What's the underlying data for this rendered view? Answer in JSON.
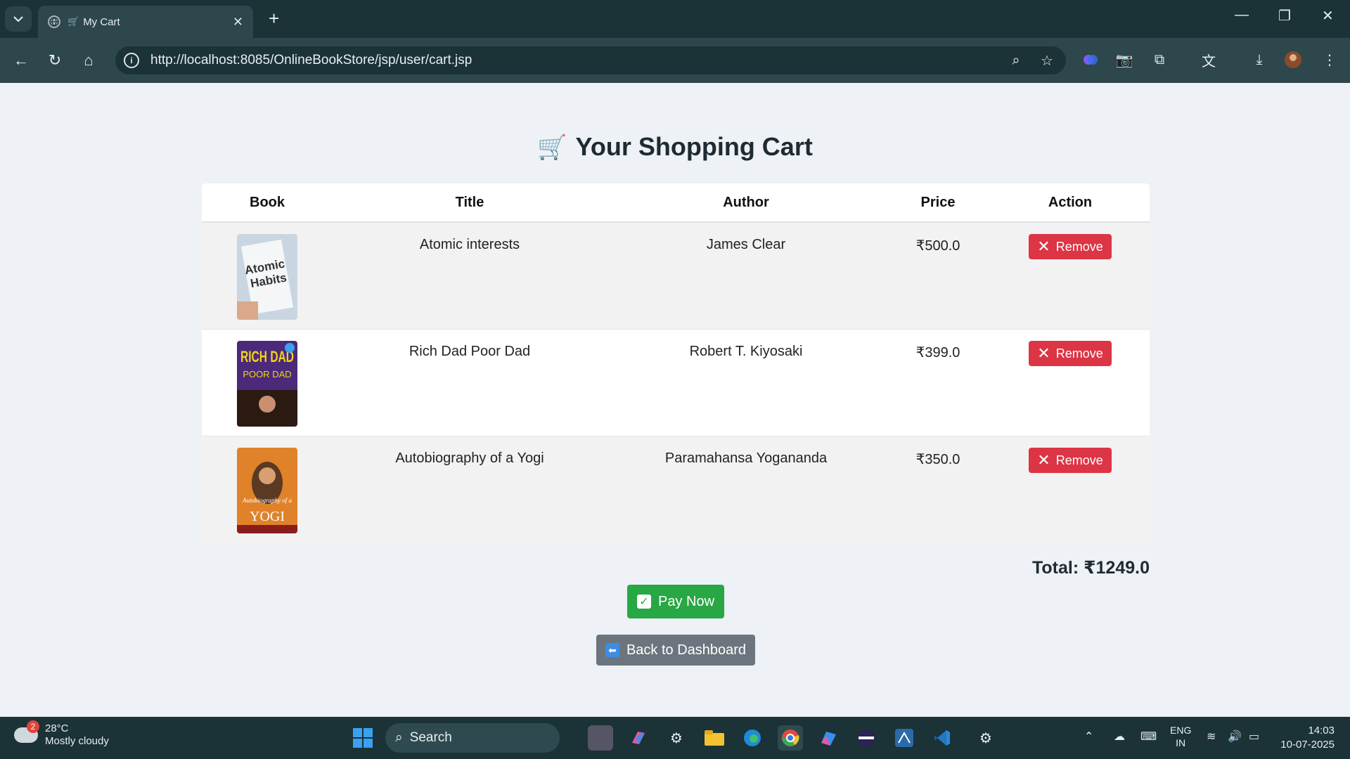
{
  "browser": {
    "tab_title": "My Cart",
    "tab_icon": "shopping-cart-icon",
    "url": "http://localhost:8085/OnlineBookStore/jsp/user/cart.jsp"
  },
  "page": {
    "heading": "Your Shopping Cart",
    "columns": [
      "Book",
      "Title",
      "Author",
      "Price",
      "Action"
    ],
    "items": [
      {
        "title": "Atomic interests",
        "author": "James Clear",
        "price": "₹500.0",
        "action": "Remove",
        "cover_text_top": "Atomic",
        "cover_text_bottom": "Habits",
        "cover_color": "#c9d6e2"
      },
      {
        "title": "Rich Dad Poor Dad",
        "author": "Robert T. Kiyosaki",
        "price": "₹399.0",
        "action": "Remove",
        "cover_text_top": "RICH DAD",
        "cover_text_bottom": "POOR DAD",
        "cover_color": "#4b2a7a"
      },
      {
        "title": "Autobiography of a Yogi",
        "author": "Paramahansa Yogananda",
        "price": "₹350.0",
        "action": "Remove",
        "cover_text_top": "Autobiography of a",
        "cover_text_bottom": "YOGI",
        "cover_color": "#e0822a"
      }
    ],
    "total": "Total: ₹1249.0",
    "pay_label": "Pay Now",
    "back_label": "Back to Dashboard"
  },
  "taskbar": {
    "weather_badge": "2",
    "temperature": "28°C",
    "weather_desc": "Mostly cloudy",
    "search_label": "Search",
    "lang_top": "ENG",
    "lang_bottom": "IN",
    "time": "14:03",
    "date": "10-07-2025"
  },
  "colors": {
    "remove": "#dc3545",
    "pay": "#28a745",
    "back": "#6c757d",
    "chrome": "#1b3237"
  }
}
